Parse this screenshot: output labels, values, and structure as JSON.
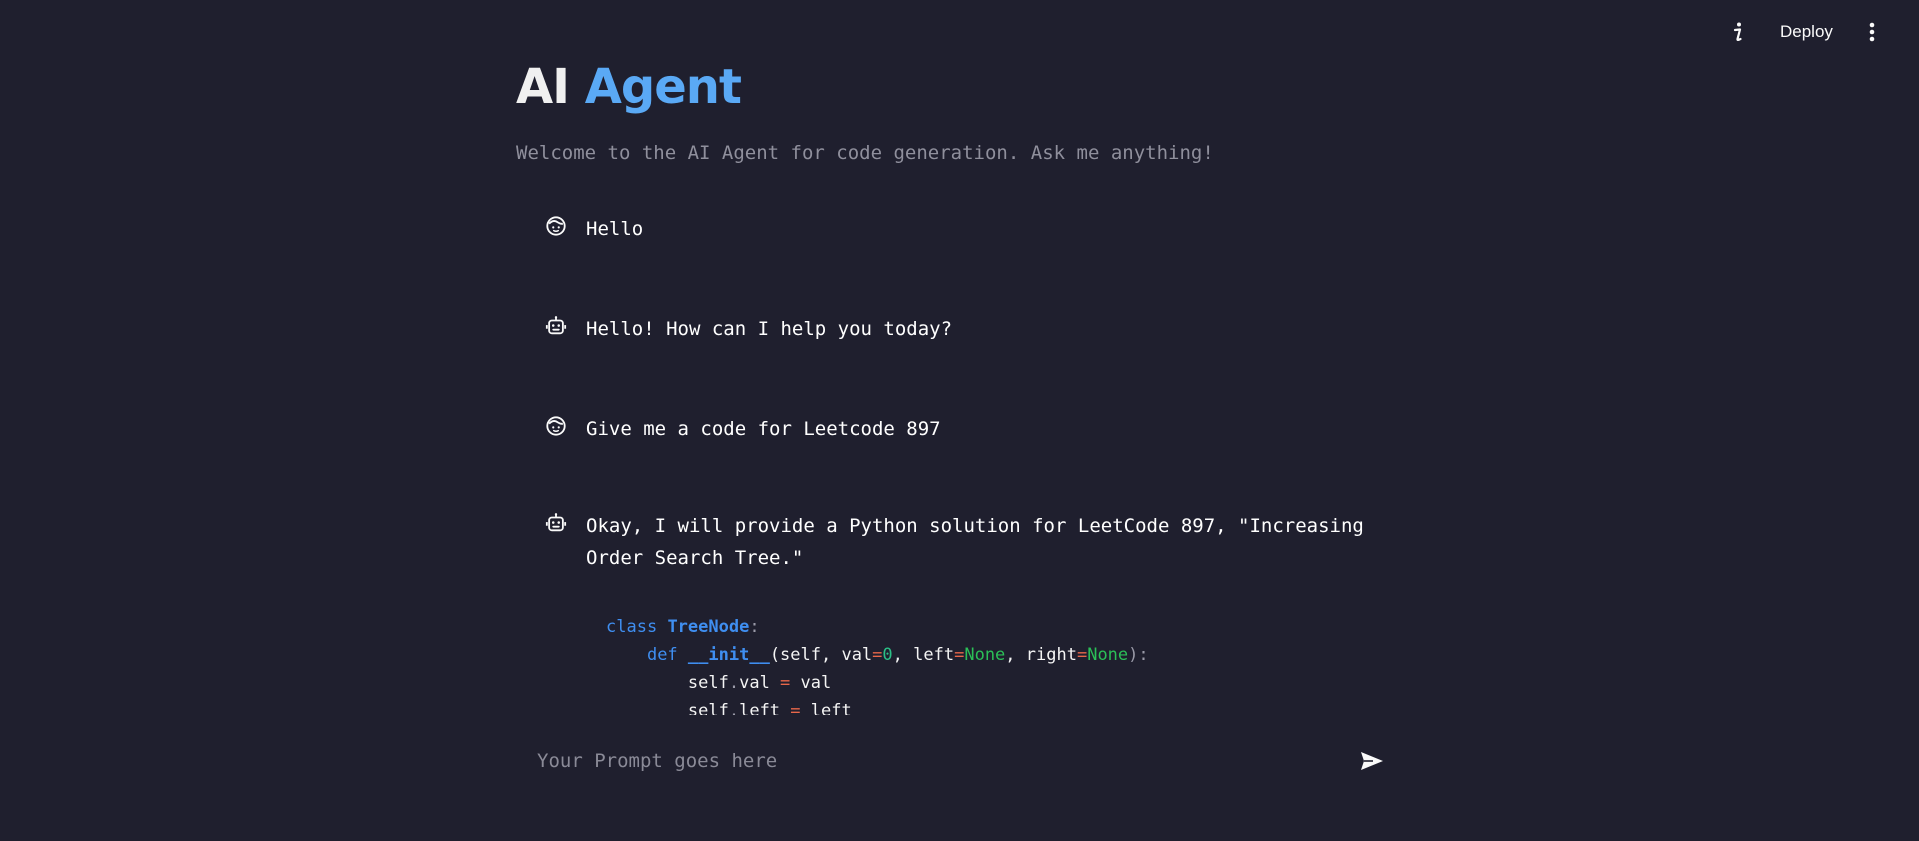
{
  "header": {
    "info_icon": "info-icon",
    "deploy_label": "Deploy",
    "menu_icon": "more-vertical-icon"
  },
  "page": {
    "title_part1": "AI",
    "title_part2": "Agent",
    "subtitle": "Welcome to the AI Agent for code generation. Ask me anything!"
  },
  "messages": [
    {
      "role": "user",
      "icon": "user-face-icon",
      "text": "Hello"
    },
    {
      "role": "assistant",
      "icon": "robot-icon",
      "text": "Hello! How can I help you today?"
    },
    {
      "role": "user",
      "icon": "user-face-icon",
      "text": "Give me a code for Leetcode 897"
    },
    {
      "role": "assistant",
      "icon": "robot-icon",
      "text": "Okay, I will provide a Python solution for LeetCode 897, \"Increasing Order Search Tree.\""
    }
  ],
  "code": {
    "line1": {
      "kw": "class",
      "name": "TreeNode",
      "colon": ":"
    },
    "line2": {
      "kw": "def",
      "name": "__init__",
      "p1": "(self, val",
      "eq1": "=",
      "n1": "0",
      "p2": ", left",
      "eq2": "=",
      "c1": "None",
      "p3": ", right",
      "eq3": "=",
      "c2": "None",
      "p4": "):"
    },
    "line3": {
      "a": "self",
      "dot": ".",
      "b": "val ",
      "eq": "=",
      "c": " val"
    },
    "line4": {
      "a": "self",
      "dot": ".",
      "b": "left ",
      "eq": "=",
      "c": " left"
    }
  },
  "prompt": {
    "placeholder": "Your Prompt goes here",
    "value": "",
    "send_icon": "send-icon"
  },
  "colors": {
    "background": "#1f1f2e",
    "accent": "#5aa9f5",
    "keyword": "#3f8ef0",
    "operator": "#e8674a",
    "constant": "#2bbf57"
  }
}
